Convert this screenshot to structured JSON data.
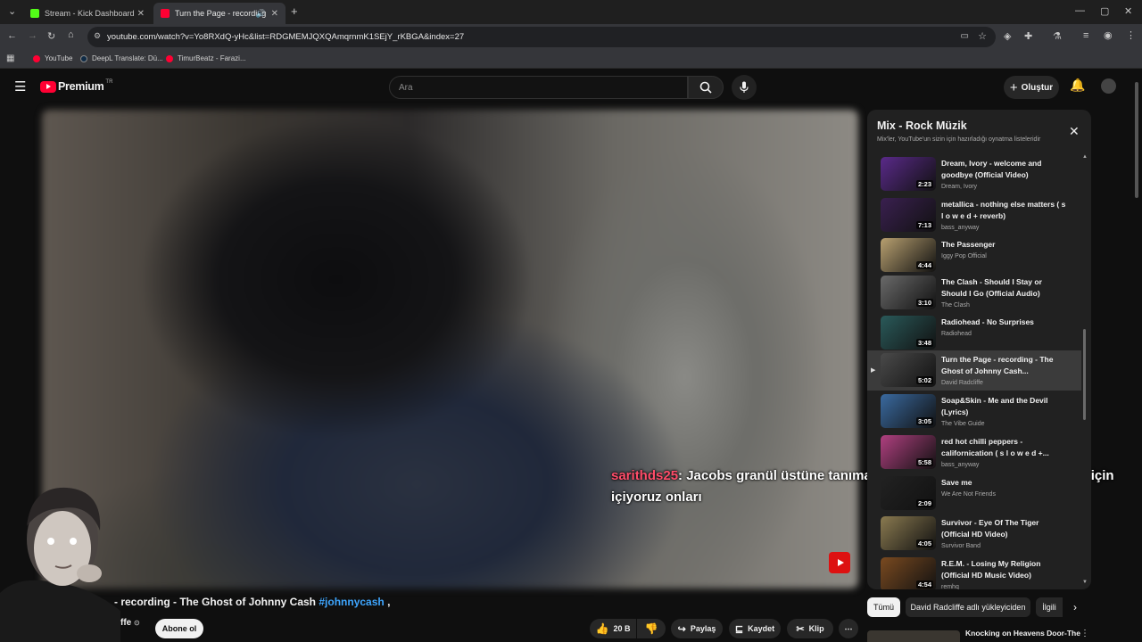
{
  "browser": {
    "tabs": [
      {
        "label": "Stream - Kick Dashboard",
        "active": false,
        "favicon_color": "#53fc18"
      },
      {
        "label": "Turn the Page - recording",
        "active": true,
        "favicon_color": "#ff0033"
      }
    ],
    "url": "youtube.com/watch?v=Yo8RXdQ-yHc&list=RDGMEMJQXQAmqrnmK1SEjY_rKBGA&index=27",
    "bookmarks": [
      {
        "label": "YouTube",
        "color": "#ff0033"
      },
      {
        "label": "DeepL Translate: Dü...",
        "color": "#0f2b46"
      },
      {
        "label": "TimurBeatz - Farazi...",
        "color": "#ff0033"
      }
    ]
  },
  "youtube": {
    "logo": "Premium",
    "logo_region": "TR",
    "search_placeholder": "Ara",
    "create_label": "Oluştur"
  },
  "chat_overlay": {
    "username": "sarithds25",
    "message": ": Jacobs granül üstüne tanımam dediklerin kahve değil ya içmek için içiyoruz onları"
  },
  "playlist": {
    "title": "Mix - Rock Müzik",
    "subtitle": "Mix'ler, YouTube'un sizin için hazırladığı oynatma listeleridir",
    "items": [
      {
        "title": "Dream, Ivory - welcome and goodbye (Official Video)",
        "channel": "Dream, Ivory",
        "duration": "2:23",
        "thumb": "#5a2a8a",
        "current": false
      },
      {
        "title": "metallica - nothing else matters ( s l o w e d + reverb)",
        "channel": "bass_anyway",
        "duration": "7:13",
        "thumb": "#3a2050",
        "current": false
      },
      {
        "title": "The Passenger",
        "channel": "Iggy Pop Official",
        "duration": "4:44",
        "thumb": "#b8a070",
        "current": false
      },
      {
        "title": "The Clash - Should I Stay or Should I Go (Official Audio)",
        "channel": "The Clash",
        "duration": "3:10",
        "thumb": "#6a6a6a",
        "current": false
      },
      {
        "title": "Radiohead - No Surprises",
        "channel": "Radiohead",
        "duration": "3:48",
        "thumb": "#2a5a5a",
        "current": false
      },
      {
        "title": "Turn the Page - recording - The Ghost of Johnny Cash...",
        "channel": "David Radcliffe",
        "duration": "5:02",
        "thumb": "#4a4a4a",
        "current": true
      },
      {
        "title": "Soap&Skin - Me and the Devil (Lyrics)",
        "channel": "The Vibe Guide",
        "duration": "3:05",
        "thumb": "#3a6aa0",
        "current": false
      },
      {
        "title": "red hot chilli peppers - californication ( s l o w e d +...",
        "channel": "bass_anyway",
        "duration": "5:58",
        "thumb": "#b04080",
        "current": false
      },
      {
        "title": "Save me",
        "channel": "We Are Not Friends",
        "duration": "2:09",
        "thumb": "#222222",
        "current": false
      },
      {
        "title": "Survivor - Eye Of The Tiger (Official HD Video)",
        "channel": "Survivor Band",
        "duration": "4:05",
        "thumb": "#8a7a50",
        "current": false
      },
      {
        "title": "R.E.M. - Losing My Religion (Official HD Music Video)",
        "channel": "remhq",
        "duration": "4:54",
        "thumb": "#7a4a20",
        "current": false
      }
    ]
  },
  "video": {
    "title": "- recording - The Ghost of Johnny Cash",
    "hashtag": "#johnnycash",
    "title_suffix": ",",
    "channel_fragment": "ffe",
    "subscribe_label": "Abone ol",
    "like_count": "20 B",
    "share_label": "Paylaş",
    "save_label": "Kaydet",
    "clip_label": "Klip"
  },
  "chips": [
    {
      "label": "Tümü",
      "active": true
    },
    {
      "label": "David Radcliffe adlı yükleyiciden",
      "active": false
    },
    {
      "label": "İlgili",
      "active": false
    }
  ],
  "recommended": {
    "title": "Knocking on Heavens Door-The"
  }
}
